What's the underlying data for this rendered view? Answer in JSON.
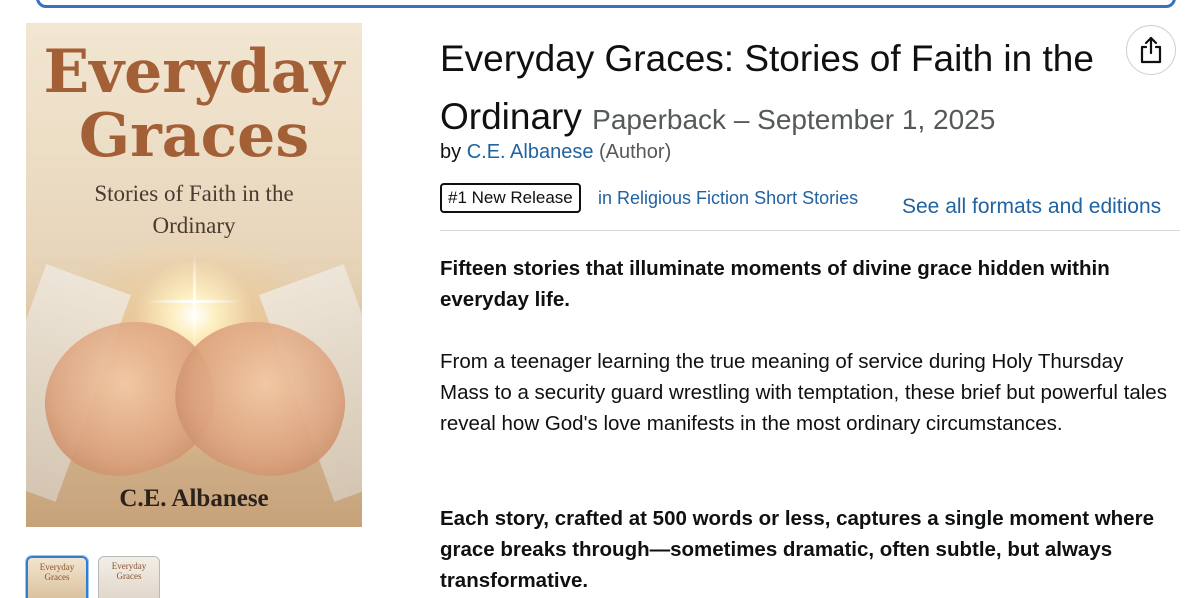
{
  "cover": {
    "title_line1": "Everyday",
    "title_line2": "Graces",
    "subtitle_line1": "Stories of Faith in the",
    "subtitle_line2": "Ordinary",
    "author": "C.E. Albanese"
  },
  "thumbnails": [
    {
      "title_line1": "Everyday",
      "title_line2": "Graces",
      "selected": true
    },
    {
      "title_line1": "Everyday",
      "title_line2": "Graces",
      "selected": false
    }
  ],
  "product": {
    "title": "Everyday Graces: Stories of Faith in the Ordinary",
    "format": "Paperback – September 1, 2025",
    "by_prefix": "by",
    "author": "C.E. Albanese",
    "author_role": "(Author)",
    "badge": "#1 New Release",
    "badge_category": "in Religious Fiction Short Stories",
    "formats_link": "See all formats and editions"
  },
  "share": {
    "icon": "share-icon"
  },
  "description": {
    "p1": "Fifteen stories that illuminate moments of divine grace hidden within everyday life.",
    "p2": "From a teenager learning the true meaning of service during Holy Thursday Mass to a security guard wrestling with temptation, these brief but powerful tales reveal how God's love manifests in the most ordinary circumstances.",
    "p3": "Each story, crafted at 500 words or less, captures a single moment where grace breaks through—sometimes dramatic, often subtle, but always transformative."
  },
  "colors": {
    "link": "#2162a1",
    "text": "#0f1111",
    "muted": "#565959",
    "search_border": "#3a6fc4",
    "cover_title": "#a35f36"
  }
}
